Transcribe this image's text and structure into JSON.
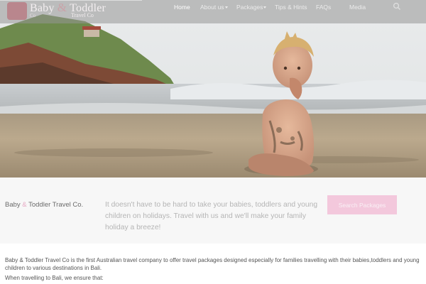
{
  "header": {
    "logo": {
      "name_part1": "Baby",
      "ampersand": "&",
      "name_part2": "Toddler",
      "subtitle": "Travel Co",
      "small_text": "Co"
    },
    "nav": [
      {
        "label": "Home",
        "active": true,
        "has_dropdown": false
      },
      {
        "label": "About us",
        "active": false,
        "has_dropdown": true
      },
      {
        "label": "Packages",
        "active": false,
        "has_dropdown": true
      },
      {
        "label": "Tips & Hints",
        "active": false,
        "has_dropdown": false
      },
      {
        "label": "FAQs",
        "active": false,
        "has_dropdown": false
      },
      {
        "label": "Media",
        "active": false,
        "has_dropdown": false
      }
    ],
    "search_icon": "search-icon"
  },
  "hero": {
    "image": "baby sitting on beach sand"
  },
  "tagline_section": {
    "brand_part1": "Baby",
    "brand_amp": "&",
    "brand_part2": "Toddler Travel Co.",
    "tagline": "It doesn't have to be hard to take your babies, toddlers and young children on holidays. Travel with us and we'll make your family holiday a breeze!",
    "button_label": "Search Packages"
  },
  "content": {
    "intro": "Baby & Toddler Travel Co is the first Australian travel company to offer travel packages designed especially for families travelling with their babies,toddlers and young children to various destinations in Bali.",
    "lead": "When travelling to Bali, we ensure that:"
  },
  "colors": {
    "accent_pink": "#f3c8dc",
    "brand_amp": "#e7a9c4",
    "nav_overlay": "#969696"
  }
}
